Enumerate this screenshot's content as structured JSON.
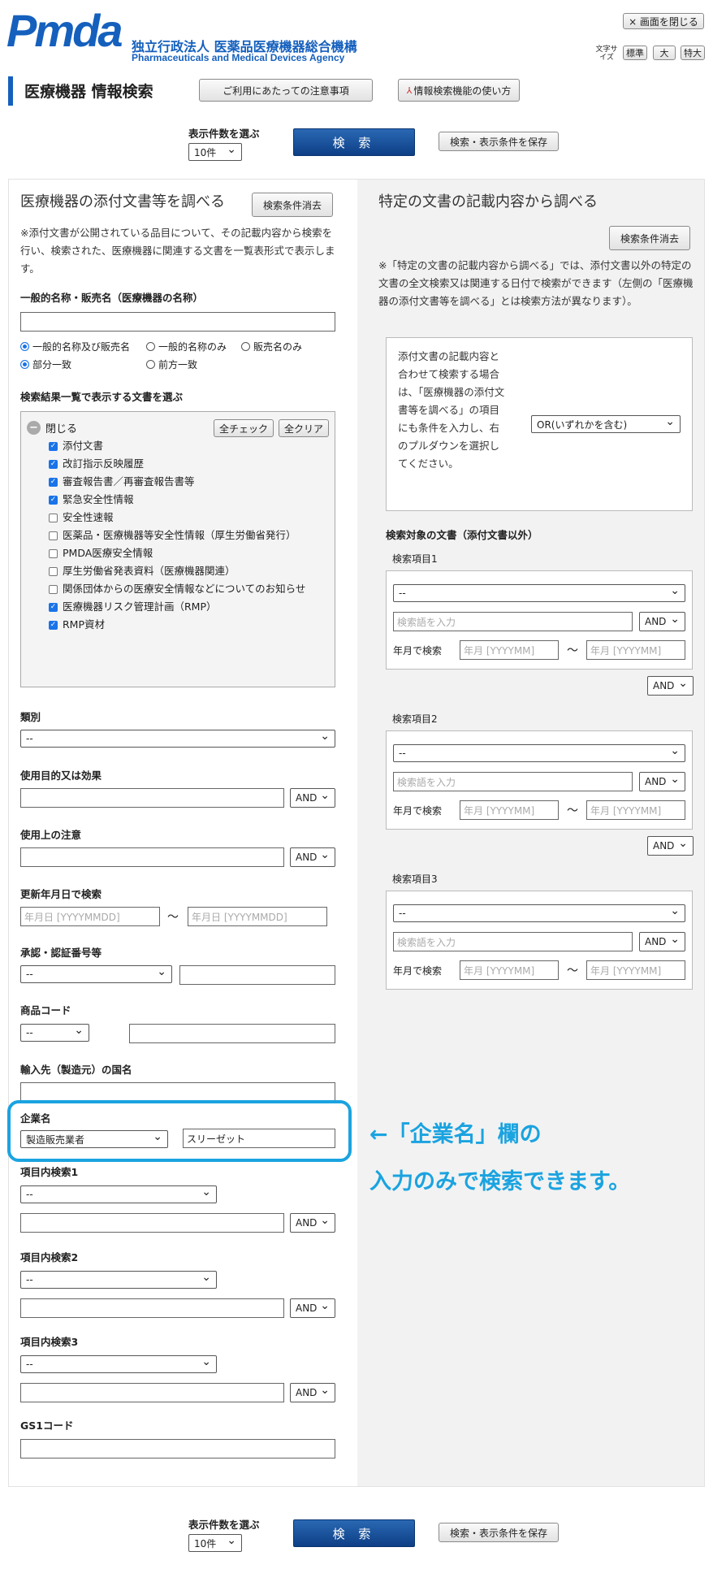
{
  "header": {
    "logo_text": "Pmda",
    "org_name_ja": "独立行政法人 医薬品医療機器総合機構",
    "org_name_en": "Pharmaceuticals and Medical Devices Agency",
    "close_label": "× 画面を閉じる",
    "font_size_label": "文字サイズ",
    "font_sizes": [
      "標準",
      "大",
      "特大"
    ]
  },
  "title_bar": {
    "page_title": "医療機器 情報検索",
    "notes_button": "ご利用にあたっての注意事項",
    "howto_button": "情報検索機能の使い方"
  },
  "top_controls": {
    "count_label": "表示件数を選ぶ",
    "count_value": "10件",
    "search_button": "検 索",
    "save_button": "検索・表示条件を保存"
  },
  "left": {
    "title": "医療機器の添付文書等を調べる",
    "clear_button": "検索条件消去",
    "note": "※添付文書が公開されている品目について、その記載内容から検索を行い、検索された、医療機器に関連する文書を一覧表形式で表示します。",
    "name_label": "一般的名称・販売名（医療機器の名称）",
    "name_radios": [
      "一般的名称及び販売名",
      "一般的名称のみ",
      "販売名のみ"
    ],
    "match_radios": [
      "部分一致",
      "前方一致"
    ],
    "doc_label": "検索結果一覧で表示する文書を選ぶ",
    "close_toggle": "閉じる",
    "check_all": "全チェック",
    "clear_all": "全クリア",
    "documents": [
      {
        "label": "添付文書",
        "checked": true
      },
      {
        "label": "改訂指示反映履歴",
        "checked": true
      },
      {
        "label": "審査報告書／再審査報告書等",
        "checked": true
      },
      {
        "label": "緊急安全性情報",
        "checked": true
      },
      {
        "label": "安全性速報",
        "checked": false
      },
      {
        "label": "医薬品・医療機器等安全性情報（厚生労働省発行）",
        "checked": false
      },
      {
        "label": "PMDA医療安全情報",
        "checked": false
      },
      {
        "label": "厚生労働省発表資料（医療機器関連）",
        "checked": false
      },
      {
        "label": "関係団体からの医療安全情報などについてのお知らせ",
        "checked": false
      },
      {
        "label": "医療機器リスク管理計画（RMP）",
        "checked": true
      },
      {
        "label": "RMP資材",
        "checked": true
      }
    ],
    "category_label": "類別",
    "purpose_label": "使用目的又は効果",
    "caution_label": "使用上の注意",
    "updated_label": "更新年月日で検索",
    "date_placeholder": "年月日 [YYYYMMDD]",
    "approval_label": "承認・認証番号等",
    "product_code_label": "商品コード",
    "import_label": "輸入先（製造元）の国名",
    "company_label": "企業名",
    "company_type": "製造販売業者",
    "company_value": "スリーゼット",
    "item1_label": "項目内検索1",
    "item2_label": "項目内検索2",
    "item3_label": "項目内検索3",
    "gs1_label": "GS1コード",
    "dash": "--",
    "and": "AND",
    "tilde": "〜"
  },
  "right": {
    "title": "特定の文書の記載内容から調べる",
    "clear_button": "検索条件消去",
    "note": "※「特定の文書の記載内容から調べる」では、添付文書以外の特定の文書の全文検索又は関連する日付で検索ができます（左側の「医療機器の添付文書等を調べる」とは検索方法が異なります）。",
    "box_text": "添付文書の記載内容と合わせて検索する場合は、「医療機器の添付文書等を調べる」の項目にも条件を入力し、右のプルダウンを選択してください。",
    "or_select": "OR(いずれかを含む)",
    "target_label": "検索対象の文書（添付文書以外）",
    "items": [
      "検索項目1",
      "検索項目2",
      "検索項目3"
    ],
    "keyword_placeholder": "検索語を入力",
    "ym_label": "年月で検索",
    "ym_placeholder": "年月 [YYYYMM]"
  },
  "callout": {
    "line1": "←「企業名」欄の",
    "line2": "入力のみで検索できます。"
  },
  "colors": {
    "brand": "#1560bd",
    "callout": "#1aa3e0",
    "primary_button": "#0d3f86"
  }
}
